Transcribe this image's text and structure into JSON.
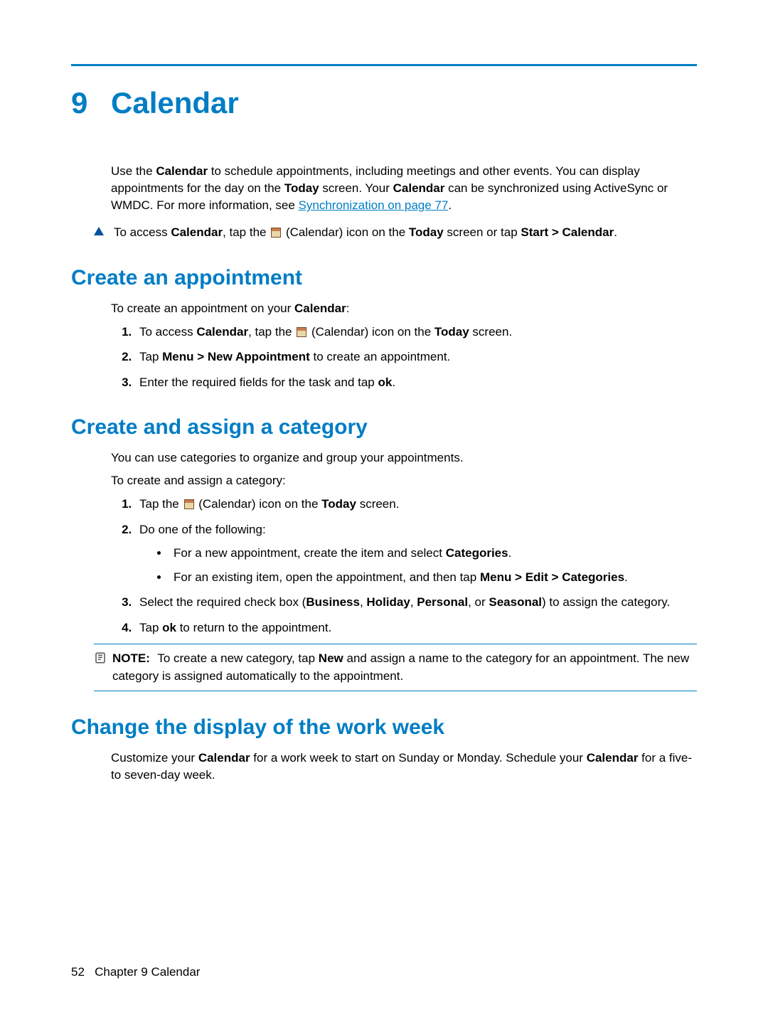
{
  "chapter": {
    "number": "9",
    "title": "Calendar"
  },
  "intro": {
    "p1_pre": "Use the ",
    "p1_b1": "Calendar",
    "p1_mid1": " to schedule appointments, including meetings and other events. You can display appointments for the day on the ",
    "p1_b2": "Today",
    "p1_mid2": " screen. Your ",
    "p1_b3": "Calendar",
    "p1_mid3": " can be synchronized using ActiveSync or WMDC. For more information, see ",
    "p1_link": "Synchronization on page 77",
    "p1_end": "."
  },
  "access": {
    "pre": "To access ",
    "b1": "Calendar",
    "mid1": ", tap the ",
    "mid2": " (Calendar) icon on the ",
    "b2": "Today",
    "mid3": " screen or tap ",
    "b3": "Start > Calendar",
    "end": "."
  },
  "s1": {
    "heading": "Create an appointment",
    "lead_pre": "To create an appointment on your ",
    "lead_b": "Calendar",
    "lead_end": ":",
    "li1_pre": "To access ",
    "li1_b1": "Calendar",
    "li1_mid1": ", tap the ",
    "li1_mid2": " (Calendar) icon on the ",
    "li1_b2": "Today",
    "li1_end": " screen.",
    "li2_pre": "Tap ",
    "li2_b": "Menu > New Appointment",
    "li2_end": " to create an appointment.",
    "li3_pre": "Enter the required fields for the task and tap ",
    "li3_b": "ok",
    "li3_end": "."
  },
  "s2": {
    "heading": "Create and assign a category",
    "p1": "You can use categories to organize and group your appointments.",
    "p2": "To create and assign a category:",
    "li1_pre": "Tap the ",
    "li1_mid": " (Calendar) icon on the ",
    "li1_b": "Today",
    "li1_end": " screen.",
    "li2": "Do one of the following:",
    "sub1_pre": "For a new appointment, create the item and select ",
    "sub1_b": "Categories",
    "sub1_end": ".",
    "sub2_pre": "For an existing item, open the appointment, and then tap ",
    "sub2_b": "Menu > Edit > Categories",
    "sub2_end": ".",
    "li3_pre": "Select the required check box (",
    "li3_b1": "Business",
    "li3_s1": ", ",
    "li3_b2": "Holiday",
    "li3_s2": ", ",
    "li3_b3": "Personal",
    "li3_s3": ", or ",
    "li3_b4": "Seasonal",
    "li3_end": ") to assign the category.",
    "li4_pre": "Tap ",
    "li4_b": "ok",
    "li4_end": " to return to the appointment.",
    "note_label": "NOTE:",
    "note_pre": "To create a new category, tap ",
    "note_b": "New",
    "note_end": " and assign a name to the category for an appointment. The new category is assigned automatically to the appointment."
  },
  "s3": {
    "heading": "Change the display of the work week",
    "p_pre": "Customize your ",
    "p_b1": "Calendar",
    "p_mid": " for a work week to start on Sunday or Monday. Schedule your ",
    "p_b2": "Calendar",
    "p_end": " for a five- to seven-day week."
  },
  "footer": {
    "page": "52",
    "chapter_label": "Chapter 9   Calendar"
  }
}
